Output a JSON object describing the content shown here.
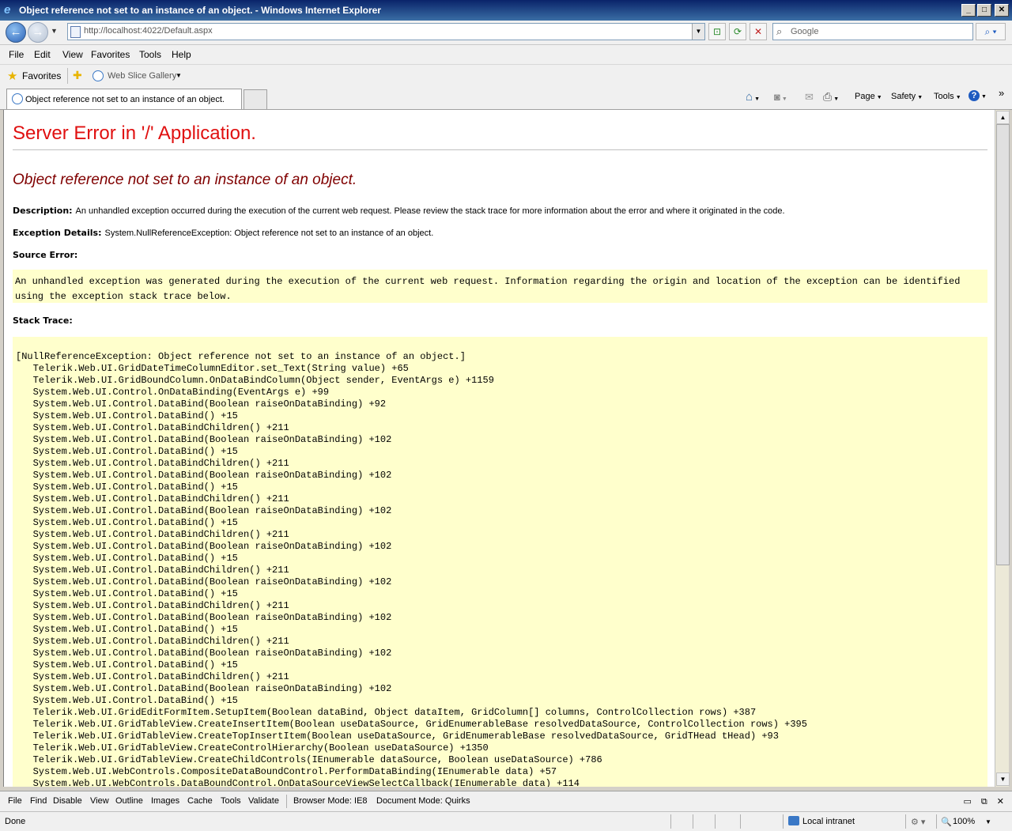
{
  "window": {
    "title": "Object reference not set to an instance of an object. - Windows Internet Explorer",
    "minimize_glyph": "_",
    "maximize_glyph": "□",
    "close_glyph": "✕"
  },
  "nav": {
    "url": "http://localhost:4022/Default.aspx",
    "search_placeholder": "Google",
    "back_glyph": "←",
    "forward_glyph": "→",
    "compat_glyph": "⊡",
    "refresh_glyph": "⟳",
    "stop_glyph": "✕",
    "search_glyph": "⌕"
  },
  "menu": {
    "file": "File",
    "edit": "Edit",
    "view": "View",
    "favorites": "Favorites",
    "tools": "Tools",
    "help": "Help"
  },
  "favorites_bar": {
    "favorites_label": "Favorites",
    "web_slice_gallery": "Web Slice Gallery"
  },
  "tab": {
    "title": "Object reference not set to an instance of an object."
  },
  "command_bar": {
    "page": "Page",
    "safety": "Safety",
    "tools": "Tools",
    "help_glyph": "?",
    "more_glyph": "»",
    "home_glyph": "⌂",
    "feeds_glyph": "◙",
    "mail_glyph": "✉",
    "print_glyph": "⎙"
  },
  "error_page": {
    "heading": "Server Error in '/' Application.",
    "subheading": "Object reference not set to an instance of an object.",
    "description_label": "Description:",
    "description_text": "An unhandled exception occurred during the execution of the current web request. Please review the stack trace for more information about the error and where it originated in the code.",
    "exception_label": "Exception Details:",
    "exception_text": "System.NullReferenceException: Object reference not set to an instance of an object.",
    "source_error_label": "Source Error:",
    "source_error_text": "An unhandled exception was generated during the execution of the current web request. Information regarding the origin and location of the exception can be identified using the exception stack trace below.",
    "stack_trace_label": "Stack Trace:",
    "stack_trace": "[NullReferenceException: Object reference not set to an instance of an object.]\n   Telerik.Web.UI.GridDateTimeColumnEditor.set_Text(String value) +65\n   Telerik.Web.UI.GridBoundColumn.OnDataBindColumn(Object sender, EventArgs e) +1159\n   System.Web.UI.Control.OnDataBinding(EventArgs e) +99\n   System.Web.UI.Control.DataBind(Boolean raiseOnDataBinding) +92\n   System.Web.UI.Control.DataBind() +15\n   System.Web.UI.Control.DataBindChildren() +211\n   System.Web.UI.Control.DataBind(Boolean raiseOnDataBinding) +102\n   System.Web.UI.Control.DataBind() +15\n   System.Web.UI.Control.DataBindChildren() +211\n   System.Web.UI.Control.DataBind(Boolean raiseOnDataBinding) +102\n   System.Web.UI.Control.DataBind() +15\n   System.Web.UI.Control.DataBindChildren() +211\n   System.Web.UI.Control.DataBind(Boolean raiseOnDataBinding) +102\n   System.Web.UI.Control.DataBind() +15\n   System.Web.UI.Control.DataBindChildren() +211\n   System.Web.UI.Control.DataBind(Boolean raiseOnDataBinding) +102\n   System.Web.UI.Control.DataBind() +15\n   System.Web.UI.Control.DataBindChildren() +211\n   System.Web.UI.Control.DataBind(Boolean raiseOnDataBinding) +102\n   System.Web.UI.Control.DataBind() +15\n   System.Web.UI.Control.DataBindChildren() +211\n   System.Web.UI.Control.DataBind(Boolean raiseOnDataBinding) +102\n   System.Web.UI.Control.DataBind() +15\n   System.Web.UI.Control.DataBindChildren() +211\n   System.Web.UI.Control.DataBind(Boolean raiseOnDataBinding) +102\n   System.Web.UI.Control.DataBind() +15\n   System.Web.UI.Control.DataBindChildren() +211\n   System.Web.UI.Control.DataBind(Boolean raiseOnDataBinding) +102\n   System.Web.UI.Control.DataBind() +15\n   Telerik.Web.UI.GridEditFormItem.SetupItem(Boolean dataBind, Object dataItem, GridColumn[] columns, ControlCollection rows) +387\n   Telerik.Web.UI.GridTableView.CreateInsertItem(Boolean useDataSource, GridEnumerableBase resolvedDataSource, ControlCollection rows) +395\n   Telerik.Web.UI.GridTableView.CreateTopInsertItem(Boolean useDataSource, GridEnumerableBase resolvedDataSource, GridTHead tHead) +93\n   Telerik.Web.UI.GridTableView.CreateControlHierarchy(Boolean useDataSource) +1350\n   Telerik.Web.UI.GridTableView.CreateChildControls(IEnumerable dataSource, Boolean useDataSource) +786\n   System.Web.UI.WebControls.CompositeDataBoundControl.PerformDataBinding(IEnumerable data) +57\n   System.Web.UI.WebControls.DataBoundControl.OnDataSourceViewSelectCallback(IEnumerable data) +114"
  },
  "developer_tools": {
    "file": "File",
    "find": "Find",
    "disable": "Disable",
    "view": "View",
    "outline": "Outline",
    "images": "Images",
    "cache": "Cache",
    "tools": "Tools",
    "validate": "Validate",
    "browser_mode": "Browser Mode: IE8",
    "document_mode": "Document Mode: Quirks"
  },
  "status": {
    "text": "Done",
    "zone": "Local intranet",
    "zoom": "100%"
  }
}
